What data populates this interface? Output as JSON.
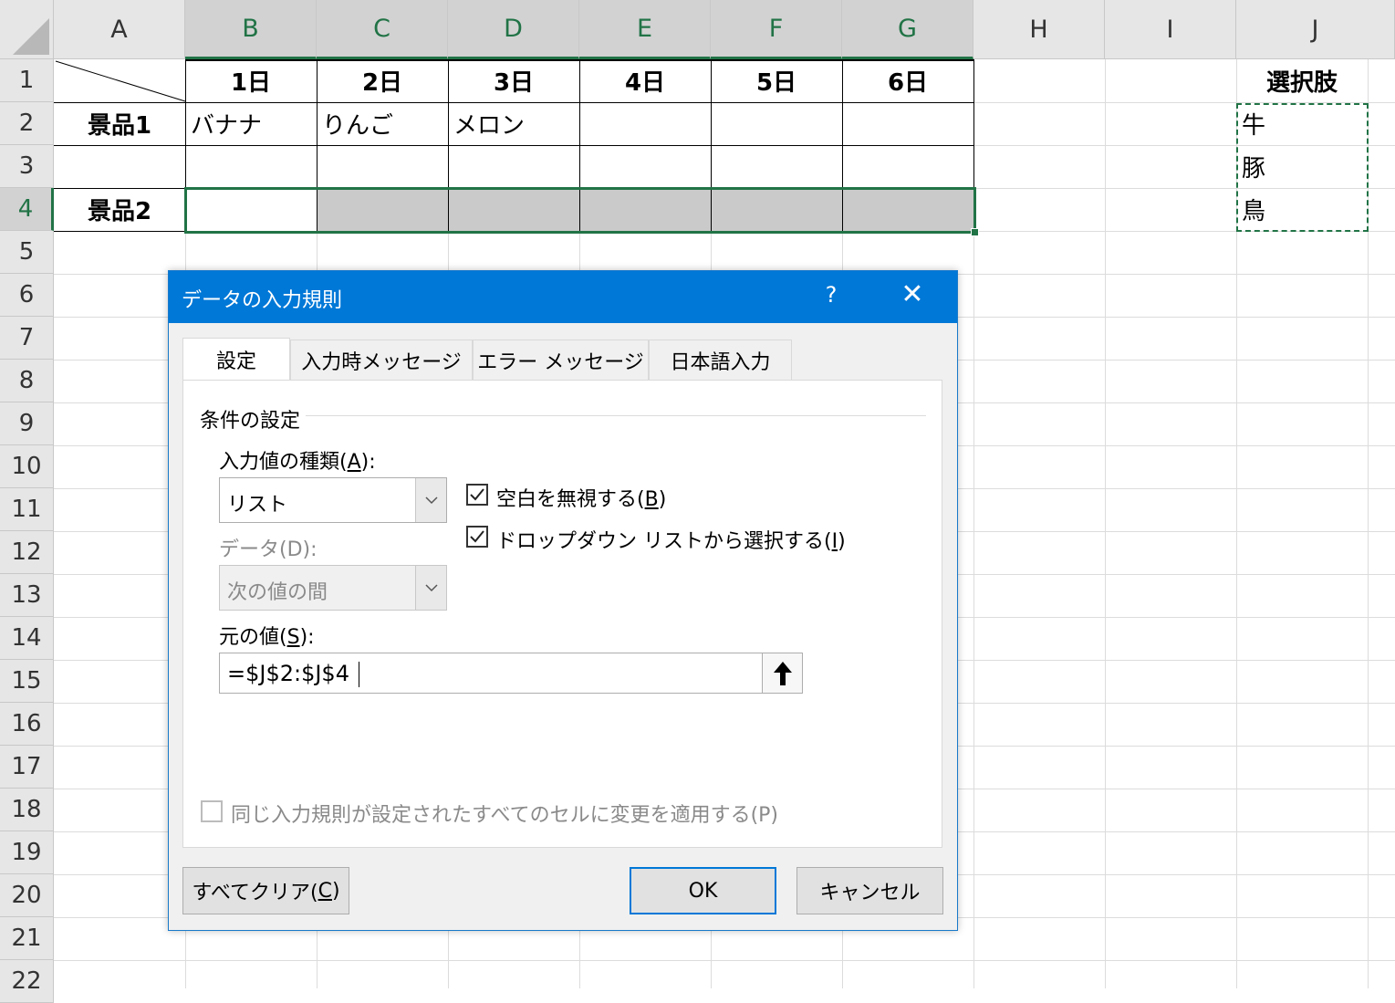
{
  "sheet": {
    "columns": [
      "A",
      "B",
      "C",
      "D",
      "E",
      "F",
      "G",
      "H",
      "I",
      "J"
    ],
    "rows": [
      "1",
      "2",
      "3",
      "4",
      "5",
      "6",
      "7",
      "8",
      "9",
      "10",
      "11",
      "12",
      "13",
      "14",
      "15",
      "16",
      "17",
      "18",
      "19",
      "20",
      "21",
      "22"
    ],
    "header_row": [
      "1日",
      "2日",
      "3日",
      "4日",
      "5日",
      "6日"
    ],
    "prize1_label": "景品1",
    "prize2_label": "景品2",
    "prize1_values": [
      "バナナ",
      "りんご",
      "メロン"
    ],
    "options_title": "選択肢",
    "options": [
      "牛",
      "豚",
      "鳥"
    ]
  },
  "dialog": {
    "title": "データの入力規則",
    "help": "?",
    "close": "✕",
    "tabs": [
      "設定",
      "入力時メッセージ",
      "エラー メッセージ",
      "日本語入力"
    ],
    "group_title": "条件の設定",
    "allow_label_pre": "入力値の種類(",
    "allow_label_key": "A",
    "allow_label_post": "):",
    "allow_value": "リスト",
    "ignore_blank_pre": "空白を無視する(",
    "ignore_blank_key": "B",
    "ignore_blank_post": ")",
    "dropdown_pre": "ドロップダウン リストから選択する(",
    "dropdown_key": "I",
    "dropdown_post": ")",
    "data_label": "データ(D):",
    "data_value": "次の値の間",
    "source_label_pre": "元の値(",
    "source_label_key": "S",
    "source_label_post": "):",
    "source_value": "=$J$2:$J$4",
    "apply_all": "同じ入力規則が設定されたすべてのセルに変更を適用する(P)",
    "clear_pre": "すべてクリア(",
    "clear_key": "C",
    "clear_post": ")",
    "ok": "OK",
    "cancel": "キャンセル"
  }
}
